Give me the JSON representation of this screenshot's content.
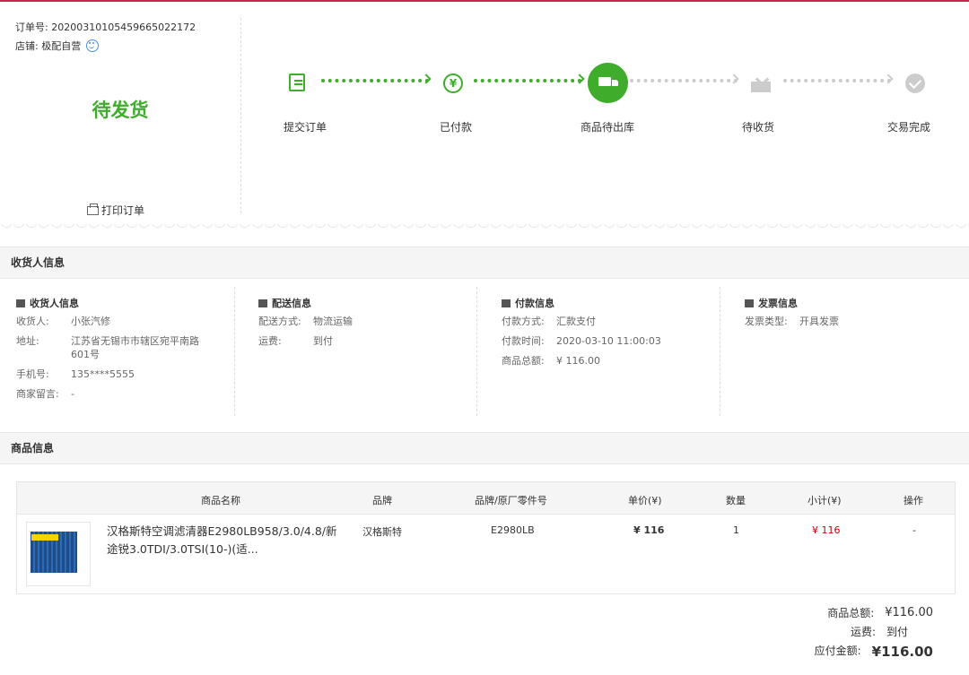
{
  "order": {
    "number": "订单号: 20200310105459665022172",
    "shop": "店铺: 极配自营",
    "status": "待发货",
    "print_label": "打印订单"
  },
  "steps": [
    {
      "label": "提交订单",
      "icon": "edit-icon",
      "state": "done"
    },
    {
      "label": "已付款",
      "icon": "yen-icon",
      "state": "done"
    },
    {
      "label": "商品待出库",
      "icon": "truck-icon",
      "state": "current"
    },
    {
      "label": "待收货",
      "icon": "box-icon",
      "state": "pending"
    },
    {
      "label": "交易完成",
      "icon": "check-icon",
      "state": "pending"
    }
  ],
  "receiver_section": {
    "title": "收货人信息",
    "receiver": {
      "title": "收货人信息",
      "name_k": "收货人:",
      "name_v": "小张汽修",
      "addr_k": "地址:",
      "addr_v": "江苏省无锡市市辖区宛平南路601号",
      "phone_k": "手机号:",
      "phone_v": "135****5555",
      "msg_k": "商家留言:",
      "msg_v": "-"
    },
    "delivery": {
      "title": "配送信息",
      "method_k": "配送方式:",
      "method_v": "物流运输",
      "fee_k": "运费:",
      "fee_v": "到付"
    },
    "payment": {
      "title": "付款信息",
      "method_k": "付款方式:",
      "method_v": "汇款支付",
      "time_k": "付款时间:",
      "time_v": "2020-03-10 11:00:03",
      "total_k": "商品总额:",
      "total_v": "¥ 116.00"
    },
    "invoice": {
      "title": "发票信息",
      "type_k": "发票类型:",
      "type_v": "开具发票"
    }
  },
  "goods_section": {
    "title": "商品信息",
    "headers": {
      "name": "商品名称",
      "brand": "品牌",
      "part": "品牌/原厂零件号",
      "price": "单价(¥)",
      "qty": "数量",
      "subtotal": "小计(¥)",
      "action": "操作"
    },
    "item": {
      "name": "汉格斯特空调滤清器E2980LB958/3.0/4.8/新途锐3.0TDI/3.0TSI(10-)(适...",
      "brand": "汉格斯特",
      "part": "E2980LB",
      "price": "¥ 116",
      "qty": "1",
      "subtotal": "¥ 116",
      "action": "-"
    }
  },
  "summary": {
    "goods_k": "商品总额:",
    "goods_v": "¥116.00",
    "ship_k": "运费:",
    "ship_v": "到付",
    "pay_k": "应付金额:",
    "pay_v": "¥116.00"
  },
  "colors": {
    "accent": "#3fad2b",
    "price_red": "#c00000",
    "topline": "#c4284b"
  }
}
